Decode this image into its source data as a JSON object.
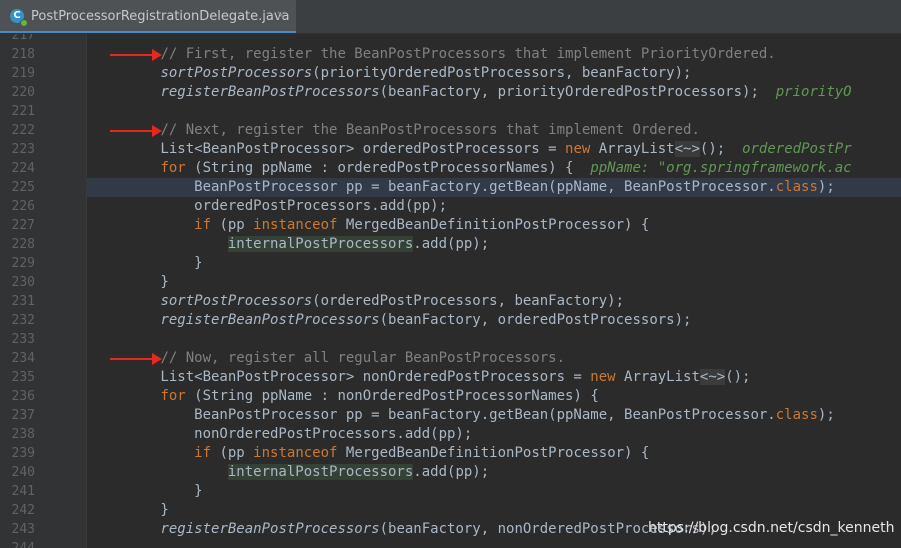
{
  "tab": {
    "title": "PostProcessorRegistrationDelegate.java",
    "close": "×",
    "icon_glyph": "C"
  },
  "watermark": "https://blog.csdn.net/csdn_kenneth",
  "colors": {
    "background": "#2b2b2b",
    "keyword": "#cc7832",
    "comment": "#808080",
    "field": "#9876aa",
    "hint": "#629755",
    "arrow": "#e8281e"
  },
  "arrows_at_lines": [
    "218",
    "222",
    "234"
  ],
  "lines": [
    {
      "n": "217",
      "tokens": []
    },
    {
      "n": "218",
      "tokens": [
        [
          "p",
          "        "
        ],
        [
          "c",
          "// First, register the BeanPostProcessors that implement PriorityOrdered."
        ]
      ]
    },
    {
      "n": "219",
      "tokens": [
        [
          "p",
          "        "
        ],
        [
          "m",
          "sortPostProcessors"
        ],
        [
          "p",
          "(priorityOrderedPostProcessors, beanFactory);"
        ]
      ]
    },
    {
      "n": "220",
      "tokens": [
        [
          "p",
          "        "
        ],
        [
          "m",
          "registerBeanPostProcessors"
        ],
        [
          "p",
          "(beanFactory, priorityOrderedPostProcessors);  "
        ],
        [
          "h",
          "priorityO"
        ]
      ]
    },
    {
      "n": "221",
      "tokens": []
    },
    {
      "n": "222",
      "tokens": [
        [
          "p",
          "        "
        ],
        [
          "c",
          "// Next, register the BeanPostProcessors that implement Ordered."
        ]
      ]
    },
    {
      "n": "223",
      "tokens": [
        [
          "p",
          "        List<BeanPostProcessor> orderedPostProcessors = "
        ],
        [
          "k",
          "new"
        ],
        [
          "p",
          " ArrayList"
        ],
        [
          "g",
          "<~>"
        ],
        [
          "p",
          "();  "
        ],
        [
          "h",
          "orderedPostPr"
        ]
      ]
    },
    {
      "n": "224",
      "tokens": [
        [
          "p",
          "        "
        ],
        [
          "k",
          "for"
        ],
        [
          "p",
          " (String ppName : orderedPostProcessorNames) {  "
        ],
        [
          "h",
          "ppName: \"org.springframework.ac"
        ]
      ]
    },
    {
      "n": "225",
      "current": true,
      "tokens": [
        [
          "p",
          "            BeanPostProcessor pp = beanFactory.getBean(ppName, BeanPostProcessor."
        ],
        [
          "k",
          "class"
        ],
        [
          "p",
          ");"
        ]
      ]
    },
    {
      "n": "226",
      "tokens": [
        [
          "p",
          "            orderedPostProcessors.add(pp);"
        ]
      ]
    },
    {
      "n": "227",
      "tokens": [
        [
          "p",
          "            "
        ],
        [
          "k",
          "if"
        ],
        [
          "p",
          " (pp "
        ],
        [
          "k",
          "instanceof"
        ],
        [
          "p",
          " MergedBeanDefinitionPostProcessor) {"
        ]
      ]
    },
    {
      "n": "228",
      "tokens": [
        [
          "p",
          "                "
        ],
        [
          "w",
          "internalPostProcessors"
        ],
        [
          "p",
          ".add(pp);"
        ]
      ]
    },
    {
      "n": "229",
      "tokens": [
        [
          "p",
          "            }"
        ]
      ]
    },
    {
      "n": "230",
      "tokens": [
        [
          "p",
          "        }"
        ]
      ]
    },
    {
      "n": "231",
      "tokens": [
        [
          "p",
          "        "
        ],
        [
          "m",
          "sortPostProcessors"
        ],
        [
          "p",
          "(orderedPostProcessors, beanFactory);"
        ]
      ]
    },
    {
      "n": "232",
      "tokens": [
        [
          "p",
          "        "
        ],
        [
          "m",
          "registerBeanPostProcessors"
        ],
        [
          "p",
          "(beanFactory, orderedPostProcessors);"
        ]
      ]
    },
    {
      "n": "233",
      "tokens": []
    },
    {
      "n": "234",
      "tokens": [
        [
          "p",
          "        "
        ],
        [
          "c",
          "// Now, register all regular BeanPostProcessors."
        ]
      ]
    },
    {
      "n": "235",
      "tokens": [
        [
          "p",
          "        List<BeanPostProcessor> nonOrderedPostProcessors = "
        ],
        [
          "k",
          "new"
        ],
        [
          "p",
          " ArrayList"
        ],
        [
          "g",
          "<~>"
        ],
        [
          "p",
          "();"
        ]
      ]
    },
    {
      "n": "236",
      "tokens": [
        [
          "p",
          "        "
        ],
        [
          "k",
          "for"
        ],
        [
          "p",
          " (String ppName : nonOrderedPostProcessorNames) {"
        ]
      ]
    },
    {
      "n": "237",
      "tokens": [
        [
          "p",
          "            BeanPostProcessor pp = beanFactory.getBean(ppName, BeanPostProcessor."
        ],
        [
          "k",
          "class"
        ],
        [
          "p",
          ");"
        ]
      ]
    },
    {
      "n": "238",
      "tokens": [
        [
          "p",
          "            nonOrderedPostProcessors.add(pp);"
        ]
      ]
    },
    {
      "n": "239",
      "tokens": [
        [
          "p",
          "            "
        ],
        [
          "k",
          "if"
        ],
        [
          "p",
          " (pp "
        ],
        [
          "k",
          "instanceof"
        ],
        [
          "p",
          " MergedBeanDefinitionPostProcessor) {"
        ]
      ]
    },
    {
      "n": "240",
      "tokens": [
        [
          "p",
          "                "
        ],
        [
          "w",
          "internalPostProcessors"
        ],
        [
          "p",
          ".add(pp);"
        ]
      ]
    },
    {
      "n": "241",
      "tokens": [
        [
          "p",
          "            }"
        ]
      ]
    },
    {
      "n": "242",
      "tokens": [
        [
          "p",
          "        }"
        ]
      ]
    },
    {
      "n": "243",
      "tokens": [
        [
          "p",
          "        "
        ],
        [
          "m",
          "registerBeanPostProcessors"
        ],
        [
          "p",
          "(beanFactory, nonOrderedPostProcessors);"
        ]
      ]
    },
    {
      "n": "244",
      "tokens": []
    }
  ]
}
